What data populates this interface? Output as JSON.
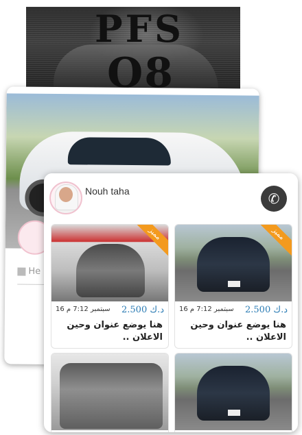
{
  "banner": {
    "logo_line1": "PFS",
    "logo_line2": "Q8"
  },
  "back_card": {
    "date_placeholder": "He"
  },
  "profile": {
    "name": "Nouh taha",
    "call_icon": "phone-icon"
  },
  "ads": [
    {
      "badge": "مميز",
      "price": "2.500 د.ك",
      "date": "16 سبتمبر 7:12 م",
      "title": "هنا يوضع عنوان وحين الاعلان ..",
      "image": "black-kia-sedan"
    },
    {
      "badge": "مميز",
      "price": "2.500 د.ك",
      "date": "16 سبتمبر 7:12 م",
      "title": "هنا يوضع عنوان وحين الاعلان ..",
      "image": "grey-nissan-gtr"
    },
    {
      "badge": "",
      "price": "",
      "date": "",
      "title": "",
      "image": "black-kia-sedan"
    },
    {
      "badge": "",
      "price": "",
      "date": "",
      "title": "",
      "image": "silver-range-rover"
    }
  ],
  "colors": {
    "badge": "#f39a1e",
    "price": "#2a7bb4",
    "phone_button": "#3b3b3b"
  }
}
